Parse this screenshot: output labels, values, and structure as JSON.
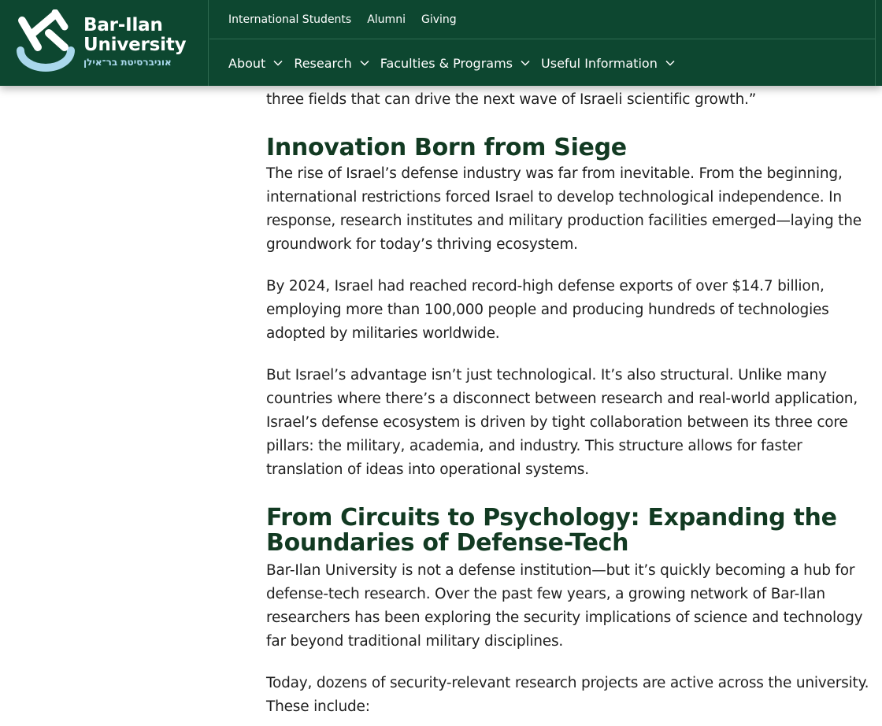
{
  "colors": {
    "header_bg": "#0d4730",
    "heading": "#123a22",
    "logo_accent": "#a9d8ec"
  },
  "logo": {
    "name_line1": "Bar-Ilan",
    "name_line2": "University",
    "hebrew": "אוניברסיטת בר־אילן",
    "icon": "bar-ilan-logo-icon"
  },
  "top_links": [
    "International Students",
    "Alumni",
    "Giving"
  ],
  "nav": [
    {
      "label": "About",
      "icon": "chevron-down-icon"
    },
    {
      "label": "Research",
      "icon": "chevron-down-icon"
    },
    {
      "label": "Faculties & Programs",
      "icon": "chevron-down-icon"
    },
    {
      "label": "Useful Information",
      "icon": "chevron-down-icon"
    }
  ],
  "article": {
    "lead_fragment": "three fields that can drive the next wave of Israeli scientific growth.”",
    "section1": {
      "heading": "Innovation Born from Siege",
      "paragraphs": [
        "The rise of Israel’s defense industry was far from inevitable. From the beginning, international restrictions forced Israel to develop technological independence. In response, research institutes and military production facilities emerged—laying the groundwork for today’s thriving ecosystem.",
        "By 2024, Israel had reached record-high defense exports of over $14.7 billion, employing more than 100,000 people and producing hundreds of technologies adopted by militaries worldwide.",
        "But Israel’s advantage isn’t just technological. It’s also structural. Unlike many countries where there’s a disconnect between research and real-world application, Israel’s defense ecosystem is driven by tight collaboration between its three core pillars: the military, academia, and industry. This structure allows for faster translation of ideas into operational systems."
      ]
    },
    "section2": {
      "heading": "From Circuits to Psychology: Expanding the Boundaries of Defense-Tech",
      "paragraphs": [
        "Bar-Ilan University is not a defense institution—but it’s quickly becoming a hub for defense-tech research. Over the past few years, a growing network of Bar-Ilan researchers has been exploring the security implications of science and technology far beyond traditional military disciplines.",
        "Today, dozens of security-relevant research projects are active across the university. These include:"
      ]
    }
  }
}
